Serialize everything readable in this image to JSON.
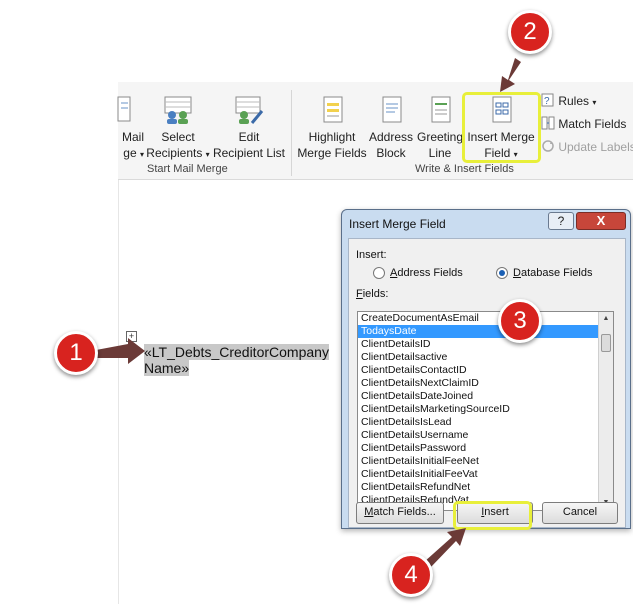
{
  "ribbon": {
    "buttons": {
      "mail": {
        "line1": "Mail",
        "line2": "ge"
      },
      "select_recipients": {
        "line1": "Select",
        "line2": "Recipients"
      },
      "edit_recipient_list": {
        "line1": "Edit",
        "line2": "Recipient List"
      },
      "highlight_merge_fields": {
        "line1": "Highlight",
        "line2": "Merge Fields"
      },
      "address_block": {
        "line1": "Address",
        "line2": "Block"
      },
      "greeting_line": {
        "line1": "Greeting",
        "line2": "Line"
      },
      "insert_merge_field": {
        "line1": "Insert Merge",
        "line2": "Field"
      }
    },
    "small": {
      "rules": "Rules",
      "match_fields": "Match Fields",
      "update_labels": "Update Labels"
    },
    "groups": {
      "start_mail_merge": "Start Mail Merge",
      "write_insert_fields": "Write & Insert Fields"
    }
  },
  "document": {
    "merge_field_line1": "«LT_Debts_CreditorCompany",
    "merge_field_line2": "Name»",
    "move_handle": "+"
  },
  "dialog": {
    "title": "Insert Merge Field",
    "help": "?",
    "close": "X",
    "insert_label": "Insert:",
    "radio_address": "Address Fields",
    "radio_database": "Database Fields",
    "selected_radio": "Database Fields",
    "fields_label": "Fields:",
    "fields": [
      "CreateDocumentAsEmail",
      "TodaysDate",
      "ClientDetailsID",
      "ClientDetailsactive",
      "ClientDetailsContactID",
      "ClientDetailsNextClaimID",
      "ClientDetailsDateJoined",
      "ClientDetailsMarketingSourceID",
      "ClientDetailsIsLead",
      "ClientDetailsUsername",
      "ClientDetailsPassword",
      "ClientDetailsInitialFeeNet",
      "ClientDetailsInitialFeeVat",
      "ClientDetailsRefundNet",
      "ClientDetailsRefundVat"
    ],
    "selected_field": "TodaysDate",
    "match_fields_button": "Match Fields...",
    "insert_button": "Insert",
    "cancel_button": "Cancel"
  },
  "callouts": [
    "1",
    "2",
    "3",
    "4"
  ],
  "colors": {
    "callout": "#d8231f",
    "highlight": "#e8ef3a",
    "selection": "#3399ff"
  }
}
